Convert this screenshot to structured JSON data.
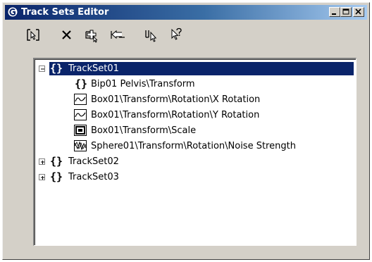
{
  "window": {
    "title": "Track Sets Editor"
  },
  "toolbar": {
    "tools": [
      {
        "icon": "select-tracks-icon"
      },
      {
        "icon": "delete-icon"
      },
      {
        "icon": "add-tracks-icon"
      },
      {
        "icon": "remove-tracks-icon"
      },
      {
        "icon": "select-curves-icon"
      },
      {
        "icon": "help-icon"
      }
    ]
  },
  "tree": {
    "items": [
      {
        "label": "TrackSet01",
        "type": "trackset",
        "expanded": true,
        "selected": true
      },
      {
        "label": "Bip01 Pelvis\\Transform",
        "type": "braces-child"
      },
      {
        "label": "Box01\\Transform\\Rotation\\X Rotation",
        "type": "curve-track"
      },
      {
        "label": "Box01\\Transform\\Rotation\\Y Rotation",
        "type": "curve-track"
      },
      {
        "label": "Box01\\Transform\\Scale",
        "type": "scale-track"
      },
      {
        "label": "Sphere01\\Transform\\Rotation\\Noise Strength",
        "type": "noise-track"
      },
      {
        "label": "TrackSet02",
        "type": "trackset",
        "expanded": false
      },
      {
        "label": "TrackSet03",
        "type": "trackset",
        "expanded": false
      }
    ]
  },
  "colors": {
    "title_active_start": "#0a246a",
    "title_active_end": "#a6caf0",
    "window_face": "#d4d0c8",
    "selection": "#0a246a"
  }
}
